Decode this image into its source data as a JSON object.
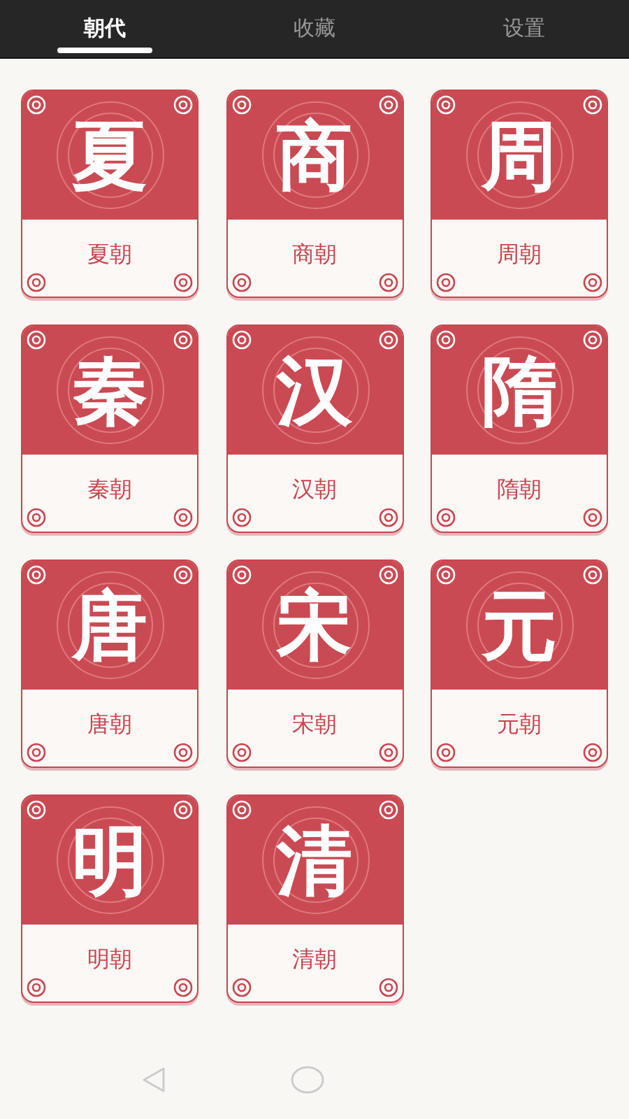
{
  "tabs": [
    {
      "label": "朝代",
      "selected": true
    },
    {
      "label": "收藏",
      "selected": false
    },
    {
      "label": "设置",
      "selected": false
    }
  ],
  "dynasties": [
    {
      "glyph": "夏",
      "label": "夏朝"
    },
    {
      "glyph": "商",
      "label": "商朝"
    },
    {
      "glyph": "周",
      "label": "周朝"
    },
    {
      "glyph": "秦",
      "label": "秦朝"
    },
    {
      "glyph": "汉",
      "label": "汉朝"
    },
    {
      "glyph": "隋",
      "label": "隋朝"
    },
    {
      "glyph": "唐",
      "label": "唐朝"
    },
    {
      "glyph": "宋",
      "label": "宋朝"
    },
    {
      "glyph": "元",
      "label": "元朝"
    },
    {
      "glyph": "明",
      "label": "明朝"
    },
    {
      "glyph": "清",
      "label": "清朝"
    }
  ]
}
